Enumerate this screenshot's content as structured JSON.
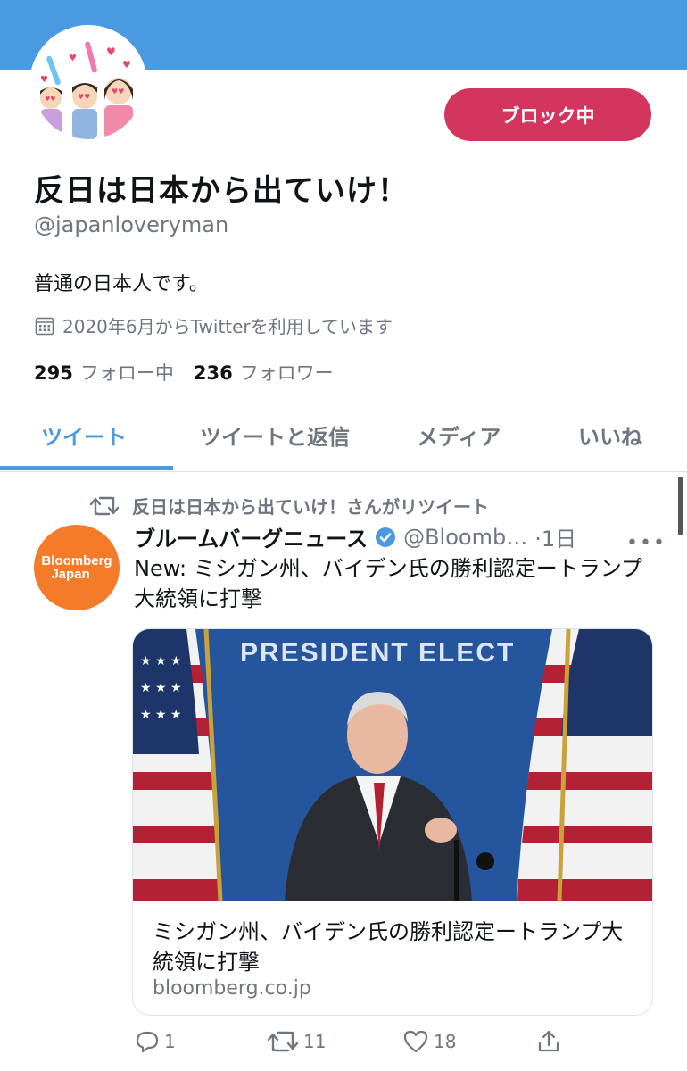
{
  "profile": {
    "block_label": "ブロック中",
    "display_name": "反日は日本から出ていけ！",
    "handle": "@japanloveryman",
    "bio": "普通の日本人です。",
    "joined": "2020年6月からTwitterを利用しています",
    "following_count": "295",
    "following_label": "フォロー中",
    "followers_count": "236",
    "followers_label": "フォロワー"
  },
  "tabs": [
    {
      "label": "ツイート",
      "active": true
    },
    {
      "label": "ツイートと返信",
      "active": false
    },
    {
      "label": "メディア",
      "active": false
    },
    {
      "label": "いいね",
      "active": false
    }
  ],
  "tweet": {
    "retweet_context": "反日は日本から出ていけ！さんがリツイート",
    "avatar_text_1": "Bloomberg",
    "avatar_text_2": "Japan",
    "author_name": "ブルームバーグニュース",
    "author_handle": "@Bloomb…",
    "time": "·1日",
    "text": "New: ミシガン州、バイデン氏の勝利認定ートランプ大統領に打撃",
    "card": {
      "image_sign_text": "PRESIDENT ELECT",
      "title": "ミシガン州、バイデン氏の勝利認定ートランプ大統領に打撃",
      "domain": "bloomberg.co.jp"
    },
    "actions": {
      "reply_count": "1",
      "retweet_count": "11",
      "like_count": "18"
    }
  },
  "colors": {
    "banner": "#4a9ae1",
    "accent": "#4a9ae1",
    "block_button": "#d4355f",
    "bloomberg_orange": "#f47b2a",
    "muted_text": "#6e7781"
  }
}
